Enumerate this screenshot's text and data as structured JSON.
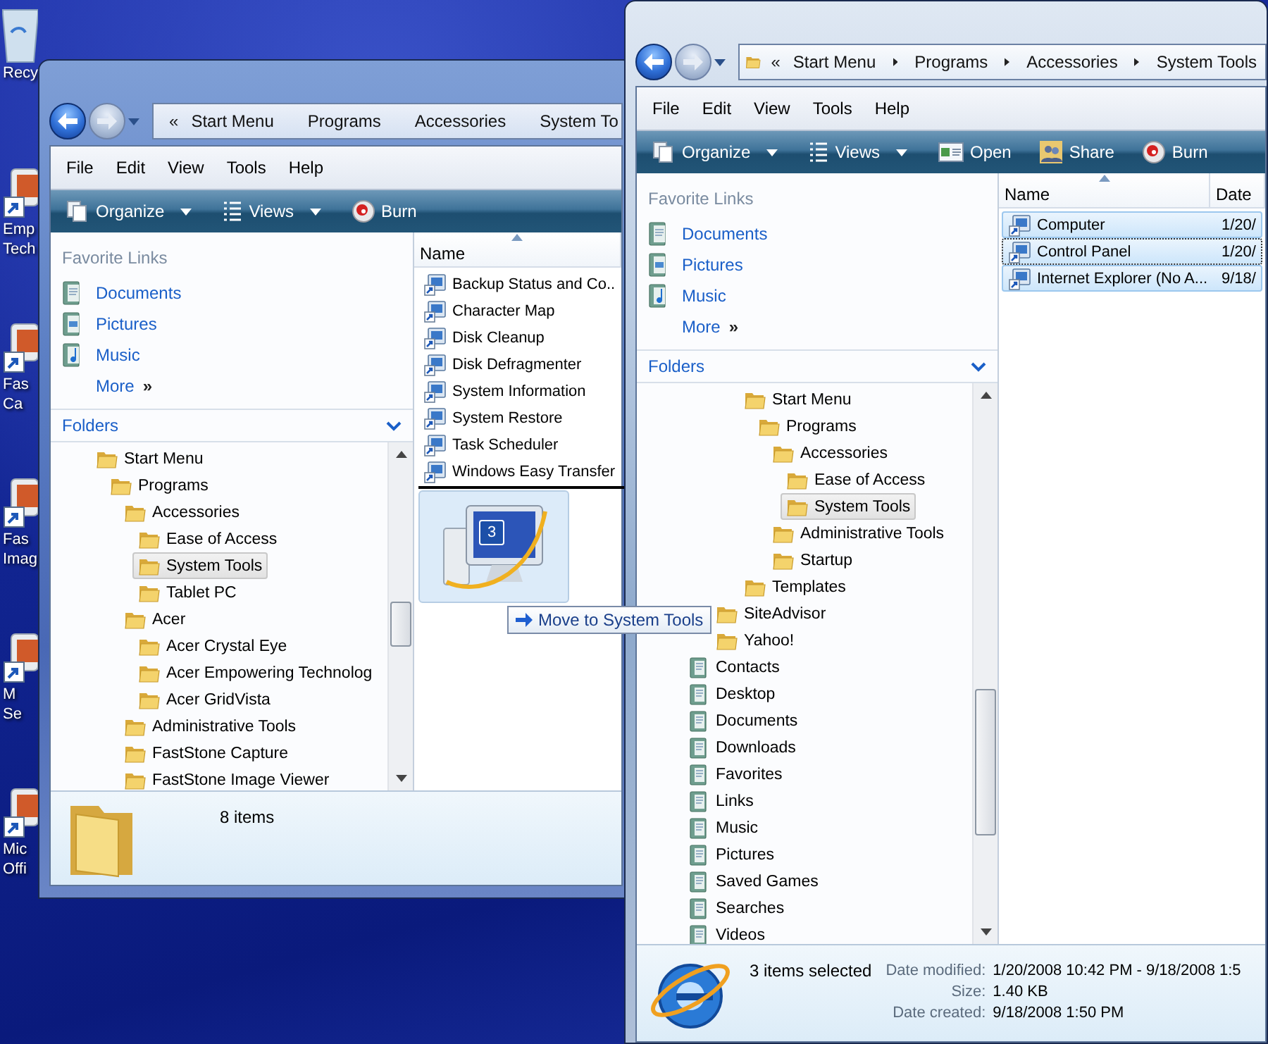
{
  "desktop_icons": [
    {
      "label": "Recy",
      "kind": "recycle-bin"
    },
    {
      "label": "Emp\nTech",
      "kind": "app"
    },
    {
      "label": "Fas\nCa",
      "kind": "app"
    },
    {
      "label": "Fas\nImag",
      "kind": "app"
    },
    {
      "label": "M\nSe",
      "kind": "app"
    },
    {
      "label": "Mic\nOffi",
      "kind": "app"
    }
  ],
  "windows": [
    {
      "nav": {
        "back_enabled": true,
        "forward_enabled": false
      },
      "address": {
        "overflow": "«",
        "crumbs": [
          "Start Menu",
          "Programs",
          "Accessories",
          "System To"
        ]
      },
      "menu": [
        "File",
        "Edit",
        "View",
        "Tools",
        "Help"
      ],
      "toolbar": [
        {
          "label": "Organize",
          "kind": "organize",
          "dropdown": true
        },
        {
          "label": "Views",
          "kind": "views",
          "dropdown": true
        },
        {
          "label": "Burn",
          "kind": "burn",
          "dropdown": false
        }
      ],
      "favorite_links": {
        "title": "Favorite Links",
        "items": [
          {
            "label": "Documents",
            "kind": "documents"
          },
          {
            "label": "Pictures",
            "kind": "pictures"
          },
          {
            "label": "Music",
            "kind": "music"
          }
        ],
        "more": "More",
        "more_glyph": "»"
      },
      "folders": {
        "title": "Folders",
        "tree": [
          {
            "label": "Start Menu",
            "kind": "folder",
            "selected": false,
            "children": [
              {
                "label": "Programs",
                "kind": "folder",
                "selected": false,
                "children": [
                  {
                    "label": "Accessories",
                    "kind": "folder",
                    "selected": false,
                    "children": [
                      {
                        "label": "Ease of Access",
                        "kind": "folder",
                        "selected": false
                      },
                      {
                        "label": "System Tools",
                        "kind": "folder",
                        "selected": true
                      },
                      {
                        "label": "Tablet PC",
                        "kind": "folder",
                        "selected": false
                      }
                    ]
                  },
                  {
                    "label": "Acer",
                    "kind": "folder",
                    "selected": false,
                    "children": [
                      {
                        "label": "Acer Crystal Eye",
                        "kind": "folder",
                        "selected": false
                      },
                      {
                        "label": "Acer Empowering Technolog",
                        "kind": "folder",
                        "selected": false
                      },
                      {
                        "label": "Acer GridVista",
                        "kind": "folder",
                        "selected": false
                      }
                    ]
                  },
                  {
                    "label": "Administrative Tools",
                    "kind": "folder",
                    "selected": false
                  },
                  {
                    "label": "FastStone Capture",
                    "kind": "folder",
                    "selected": false
                  },
                  {
                    "label": "FastStone Image Viewer",
                    "kind": "folder",
                    "selected": false
                  }
                ]
              }
            ]
          }
        ]
      },
      "file_list": {
        "columns": [
          "Name"
        ],
        "rows": [
          {
            "cells": [
              "Backup Status and Co.."
            ],
            "selected": false,
            "focused": false
          },
          {
            "cells": [
              "Character Map"
            ],
            "selected": false,
            "focused": false
          },
          {
            "cells": [
              "Disk Cleanup"
            ],
            "selected": false,
            "focused": false
          },
          {
            "cells": [
              "Disk Defragmenter"
            ],
            "selected": false,
            "focused": false
          },
          {
            "cells": [
              "System Information"
            ],
            "selected": false,
            "focused": false
          },
          {
            "cells": [
              "System Restore"
            ],
            "selected": false,
            "focused": false
          },
          {
            "cells": [
              "Task Scheduler"
            ],
            "selected": false,
            "focused": false
          },
          {
            "cells": [
              "Windows Easy Transfer"
            ],
            "selected": false,
            "focused": false
          }
        ]
      },
      "details": {
        "kind": "folder",
        "summary": "8 items"
      }
    },
    {
      "nav": {
        "back_enabled": true,
        "forward_enabled": false
      },
      "address": {
        "overflow": "«",
        "crumbs": [
          "Start Menu",
          "Programs",
          "Accessories",
          "System Tools"
        ]
      },
      "menu": [
        "File",
        "Edit",
        "View",
        "Tools",
        "Help"
      ],
      "toolbar": [
        {
          "label": "Organize",
          "kind": "organize",
          "dropdown": true
        },
        {
          "label": "Views",
          "kind": "views",
          "dropdown": true
        },
        {
          "label": "Open",
          "kind": "open",
          "dropdown": false
        },
        {
          "label": "Share",
          "kind": "share",
          "dropdown": false
        },
        {
          "label": "Burn",
          "kind": "burn",
          "dropdown": false
        }
      ],
      "favorite_links": {
        "title": "Favorite Links",
        "items": [
          {
            "label": "Documents",
            "kind": "documents"
          },
          {
            "label": "Pictures",
            "kind": "pictures"
          },
          {
            "label": "Music",
            "kind": "music"
          }
        ],
        "more": "More",
        "more_glyph": "»"
      },
      "folders": {
        "title": "Folders",
        "tree": [
          {
            "children": [
              {
                "children": [
                  {
                    "children": [
                      {
                        "children": [
                          {
                            "label": "Start Menu",
                            "kind": "folder",
                            "selected": false,
                            "children": [
                              {
                                "label": "Programs",
                                "kind": "folder",
                                "selected": false,
                                "children": [
                                  {
                                    "label": "Accessories",
                                    "kind": "folder",
                                    "selected": false,
                                    "children": [
                                      {
                                        "label": "Ease of Access",
                                        "kind": "folder",
                                        "selected": false
                                      },
                                      {
                                        "label": "System Tools",
                                        "kind": "folder",
                                        "selected": true
                                      }
                                    ]
                                  },
                                  {
                                    "label": "Administrative Tools",
                                    "kind": "folder",
                                    "selected": false
                                  },
                                  {
                                    "label": "Startup",
                                    "kind": "folder",
                                    "selected": false
                                  }
                                ]
                              }
                            ]
                          },
                          {
                            "label": "Templates",
                            "kind": "folder",
                            "selected": false
                          }
                        ]
                      }
                    ]
                  },
                  {
                    "label": "SiteAdvisor",
                    "kind": "folder",
                    "selected": false
                  },
                  {
                    "label": "Yahoo!",
                    "kind": "folder",
                    "selected": false
                  }
                ]
              }
            ]
          },
          {
            "label": "Contacts",
            "kind": "library",
            "selected": false
          },
          {
            "label": "Desktop",
            "kind": "library",
            "selected": false
          },
          {
            "label": "Documents",
            "kind": "library",
            "selected": false
          },
          {
            "label": "Downloads",
            "kind": "library",
            "selected": false
          },
          {
            "label": "Favorites",
            "kind": "library",
            "selected": false
          },
          {
            "label": "Links",
            "kind": "library",
            "selected": false
          },
          {
            "label": "Music",
            "kind": "library",
            "selected": false
          },
          {
            "label": "Pictures",
            "kind": "library",
            "selected": false
          },
          {
            "label": "Saved Games",
            "kind": "library",
            "selected": false
          },
          {
            "label": "Searches",
            "kind": "library",
            "selected": false
          },
          {
            "label": "Videos",
            "kind": "library",
            "selected": false
          }
        ]
      },
      "file_list": {
        "columns": [
          "Name",
          "Date"
        ],
        "rows": [
          {
            "cells": [
              "Computer",
              "1/20/"
            ],
            "selected": true,
            "focused": false
          },
          {
            "cells": [
              "Control Panel",
              "1/20/"
            ],
            "selected": true,
            "focused": true
          },
          {
            "cells": [
              "Internet Explorer (No A...",
              "9/18/"
            ],
            "selected": true,
            "focused": false
          }
        ]
      },
      "details": {
        "kind": "globe",
        "summary": "3 items selected",
        "fields": [
          {
            "label": "Date modified:",
            "value": "1/20/2008 10:42 PM - 9/18/2008 1:5"
          },
          {
            "label": "Size:",
            "value": "1.40 KB"
          },
          {
            "label": "Date created:",
            "value": "9/18/2008 1:50 PM"
          }
        ]
      }
    }
  ],
  "drag": {
    "count": "3",
    "tooltip": "Move to System Tools"
  }
}
